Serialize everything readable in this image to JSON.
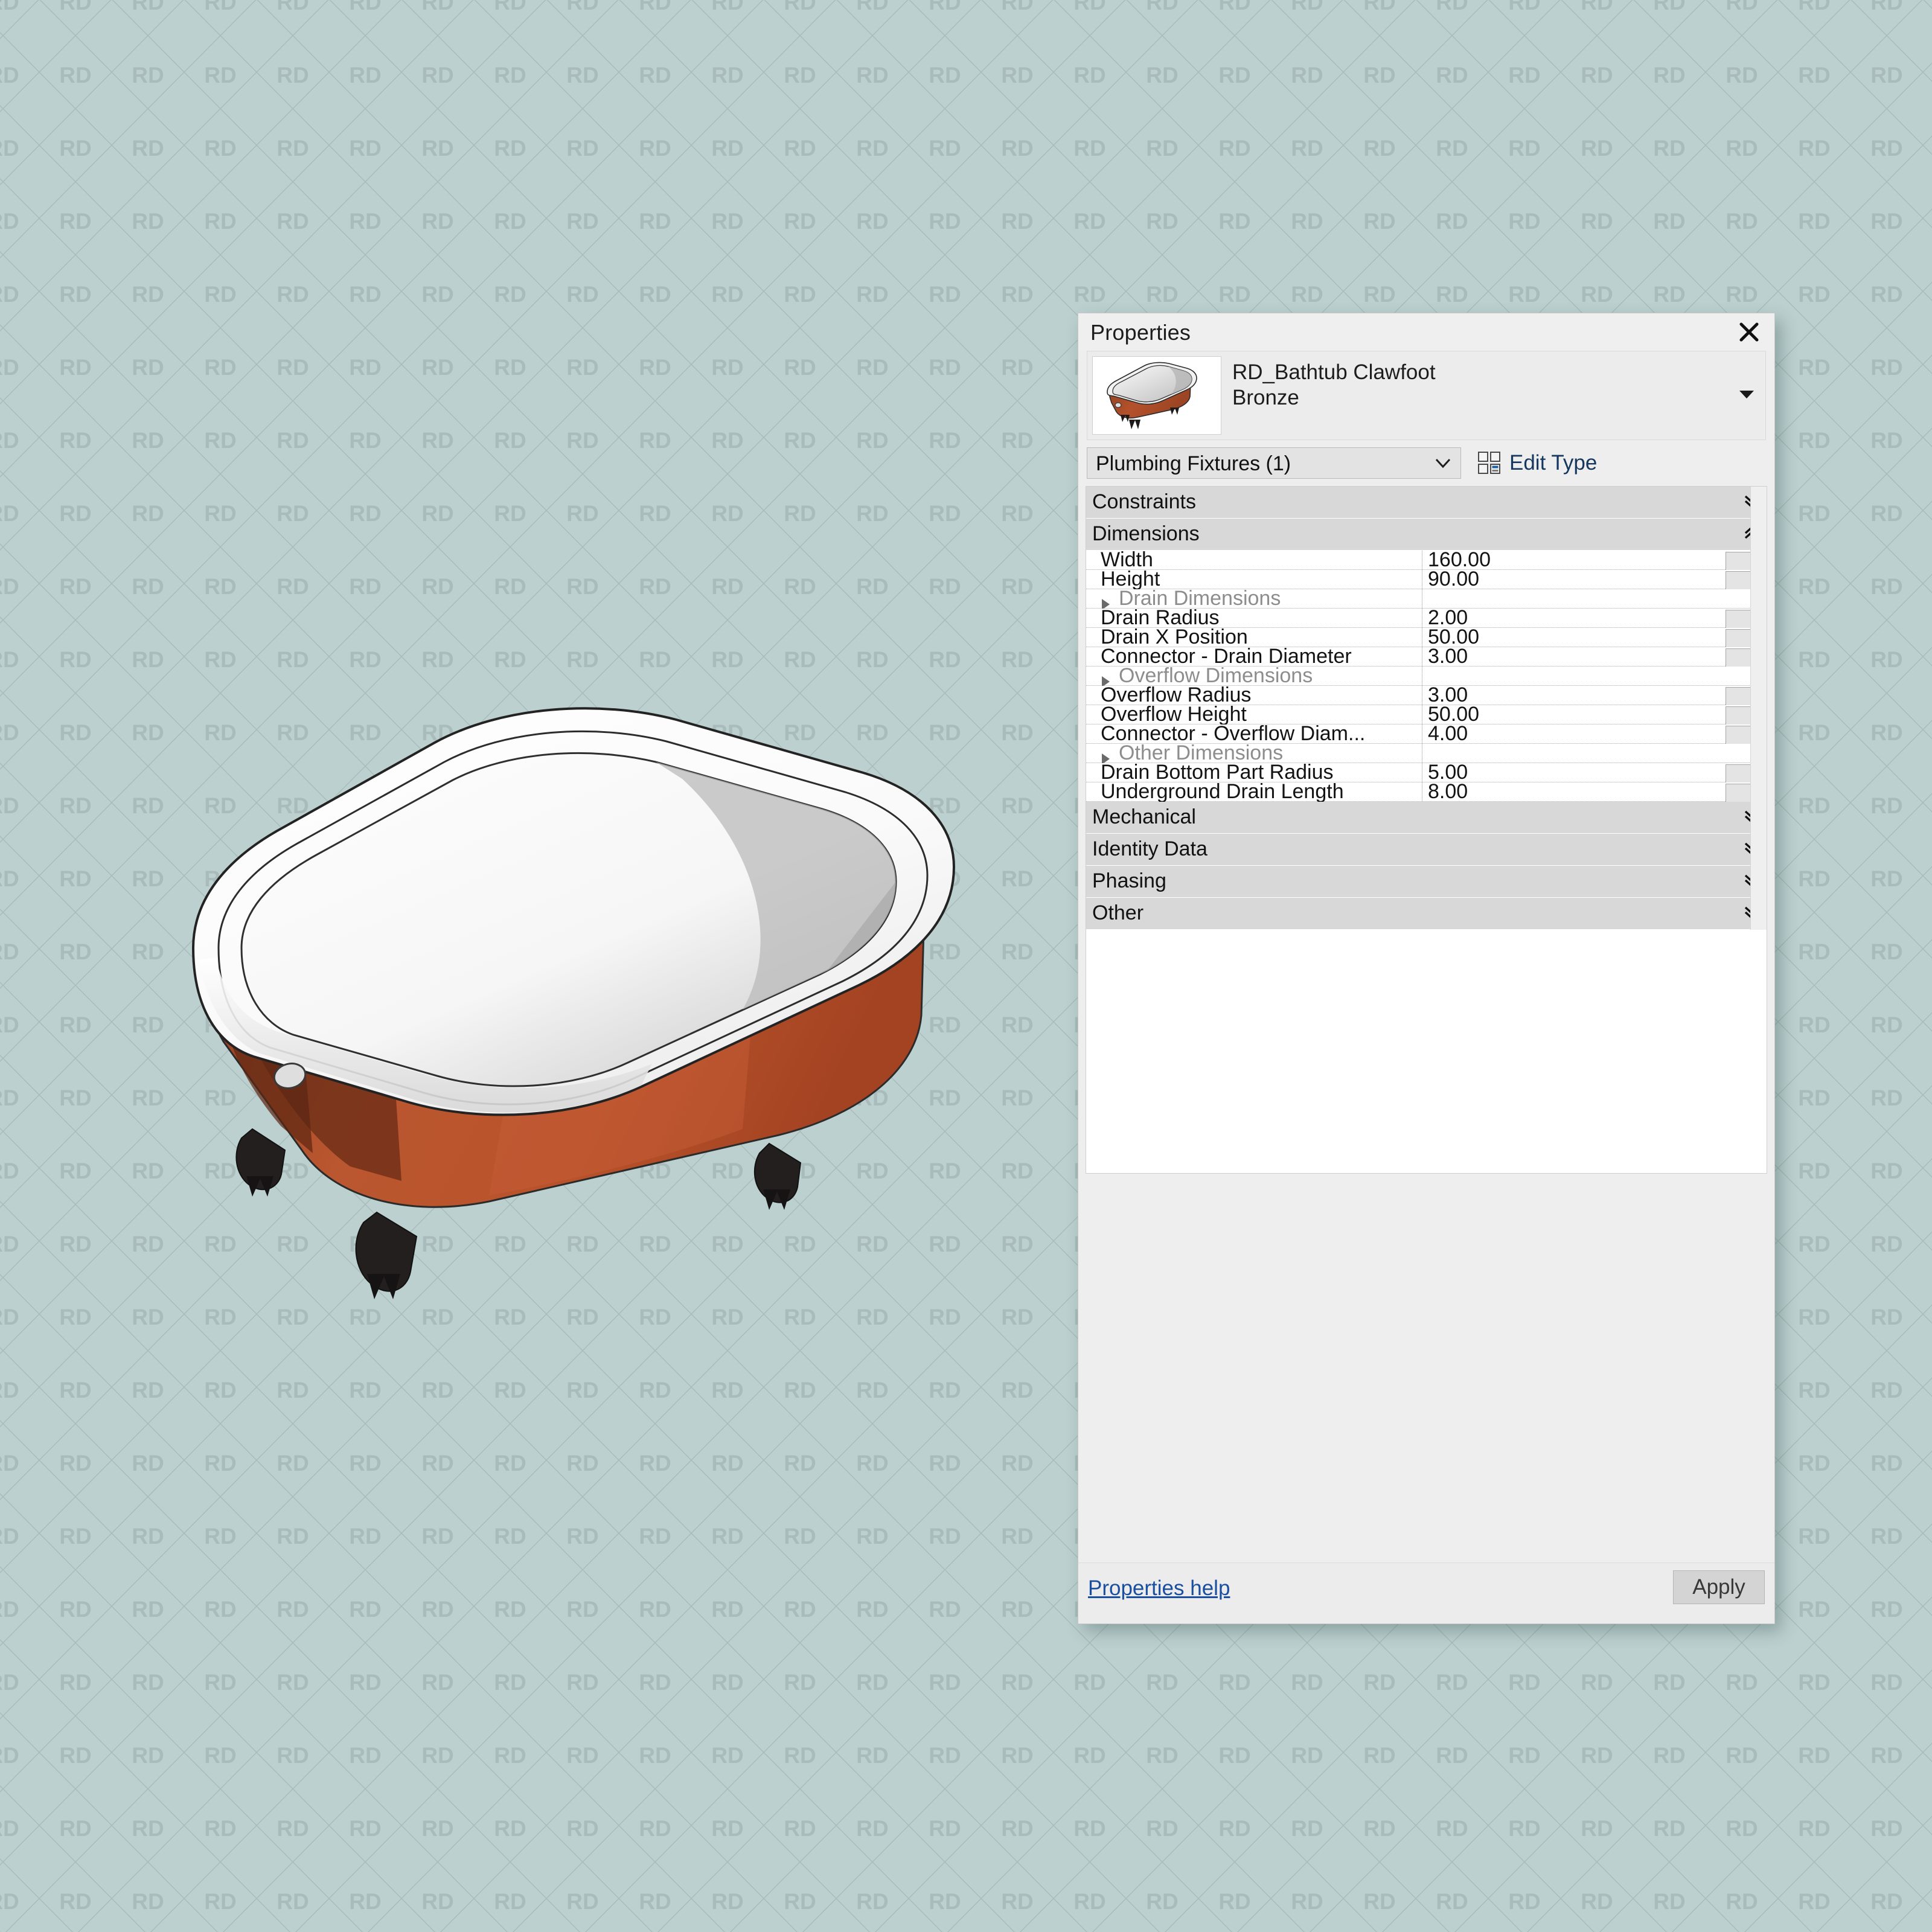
{
  "app": {
    "background_color": "#bcd0cf",
    "watermark_text": "RD"
  },
  "panel": {
    "title": "Properties",
    "close_icon": "close-icon",
    "identity": {
      "family_name": "RD_Bathtub Clawfoot",
      "type_name": "Bronze",
      "thumbnail_icon": "bathtub-thumbnail",
      "dropdown_icon": "triangle-down-icon"
    },
    "selector": {
      "category_value": "Plumbing Fixtures (1)",
      "caret_icon": "chevron-down-icon",
      "edit_type_label": "Edit Type",
      "edit_type_icon": "edit-type-icon"
    },
    "groups": [
      {
        "name": "Constraints",
        "state": "collapsed",
        "chevron_icon": "double-chevron-down-icon",
        "rows": []
      },
      {
        "name": "Dimensions",
        "state": "expanded",
        "chevron_icon": "double-chevron-up-icon",
        "rows": [
          {
            "kind": "param",
            "name": "Width",
            "value": "160.00",
            "has_button": true
          },
          {
            "kind": "param",
            "name": "Height",
            "value": "90.00",
            "has_button": true
          },
          {
            "kind": "subgroup",
            "name": "Drain Dimensions",
            "value": "",
            "has_button": false
          },
          {
            "kind": "param",
            "name": "Drain Radius",
            "value": "2.00",
            "has_button": true
          },
          {
            "kind": "param",
            "name": "Drain X Position",
            "value": "50.00",
            "has_button": true
          },
          {
            "kind": "param",
            "name": "Connector - Drain Diameter",
            "value": "3.00",
            "has_button": true
          },
          {
            "kind": "subgroup",
            "name": "Overflow Dimensions",
            "value": "",
            "has_button": false
          },
          {
            "kind": "param",
            "name": "Overflow Radius",
            "value": "3.00",
            "has_button": true
          },
          {
            "kind": "param",
            "name": "Overflow Height",
            "value": "50.00",
            "has_button": true
          },
          {
            "kind": "param",
            "name": "Connector - Overflow Diam...",
            "value": "4.00",
            "has_button": true
          },
          {
            "kind": "subgroup",
            "name": "Other Dimensions",
            "value": "",
            "has_button": false
          },
          {
            "kind": "param",
            "name": "Drain Bottom Part Radius",
            "value": "5.00",
            "has_button": true
          },
          {
            "kind": "param",
            "name": "Underground Drain Length",
            "value": "8.00",
            "has_button": true
          }
        ]
      },
      {
        "name": "Mechanical",
        "state": "collapsed",
        "chevron_icon": "double-chevron-down-icon",
        "rows": []
      },
      {
        "name": "Identity Data",
        "state": "collapsed",
        "chevron_icon": "double-chevron-down-icon",
        "rows": []
      },
      {
        "name": "Phasing",
        "state": "collapsed",
        "chevron_icon": "double-chevron-down-icon",
        "rows": []
      },
      {
        "name": "Other",
        "state": "collapsed",
        "chevron_icon": "double-chevron-down-icon",
        "rows": []
      }
    ],
    "footer": {
      "help_label": "Properties help",
      "apply_label": "Apply"
    }
  },
  "viewport": {
    "model_name": "RD_Bathtub Clawfoot Bronze",
    "colors": {
      "tub_body": "#b4512a",
      "tub_body_shadow": "#7e3219",
      "tub_rim": "#ffffff",
      "tub_interior": "#f2f2f2",
      "feet": "#231f1e"
    }
  }
}
